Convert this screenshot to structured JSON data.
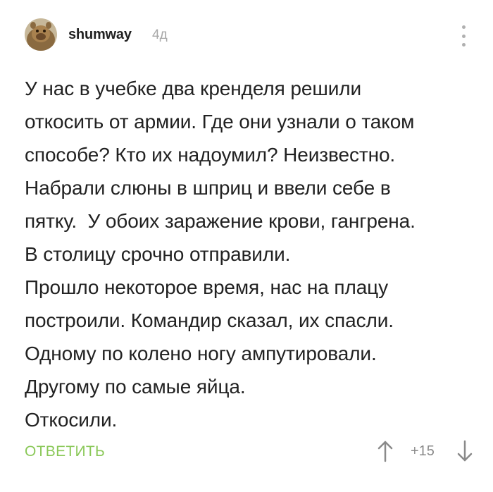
{
  "comment": {
    "author": "shumway",
    "time": "4д",
    "avatar_icon": "avatar-alf",
    "more_icon": "vertical-dots-icon",
    "body_lines": [
      "У нас в учебке два кренделя решили",
      "откосить от армии. Где они узнали о таком",
      "способе? Кто их надоумил? Неизвестно.",
      "Набрали слюны в шприц и ввели себе в",
      "пятку.  У обоих заражение крови, гангрена.",
      "В столицу срочно отправили.",
      "Прошло некоторое время, нас на плацу",
      "построили. Командир сказал, их спасли.",
      "Одному по колено ногу ампутировали.",
      "Другому по самые яйца.",
      "Откосили."
    ],
    "reply_label": "ОТВЕТИТЬ",
    "score": "+15",
    "upvote_icon": "arrow-up-icon",
    "downvote_icon": "arrow-down-icon"
  },
  "colors": {
    "reply": "#8ac858",
    "muted": "#a8a8a8",
    "text": "#222222"
  }
}
